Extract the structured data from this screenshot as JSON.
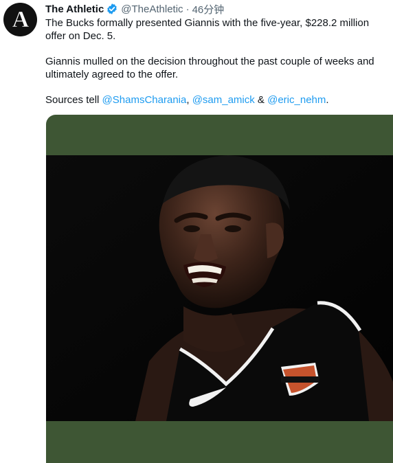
{
  "tweet": {
    "display_name": "The Athletic",
    "handle": "@TheAthletic",
    "separator": "·",
    "timestamp": "46分钟",
    "avatar_letter": "A",
    "paragraph1": "The Bucks formally presented Giannis with the five-year, $228.2 million offer on Dec. 5.",
    "paragraph2": "Giannis mulled on the decision throughout the past couple of weeks and ultimately agreed to the offer.",
    "paragraph3_prefix": "Sources tell ",
    "mention1": "@ShamsCharania",
    "comma": ", ",
    "mention2": "@sam_amick",
    "ampersand": " & ",
    "mention3": "@eric_nehm",
    "period": "."
  },
  "media": {
    "description_icon": "player-photo",
    "jersey_logo_line1": "MOTOR",
    "jersey_logo_line2": "HARLEY-DAVIDSON",
    "jersey_logo_line3": "CYCLES"
  },
  "colors": {
    "link": "#1d9bf0",
    "muted": "#536471",
    "verified": "#1d9bf0",
    "media_background": "#3e5634"
  }
}
